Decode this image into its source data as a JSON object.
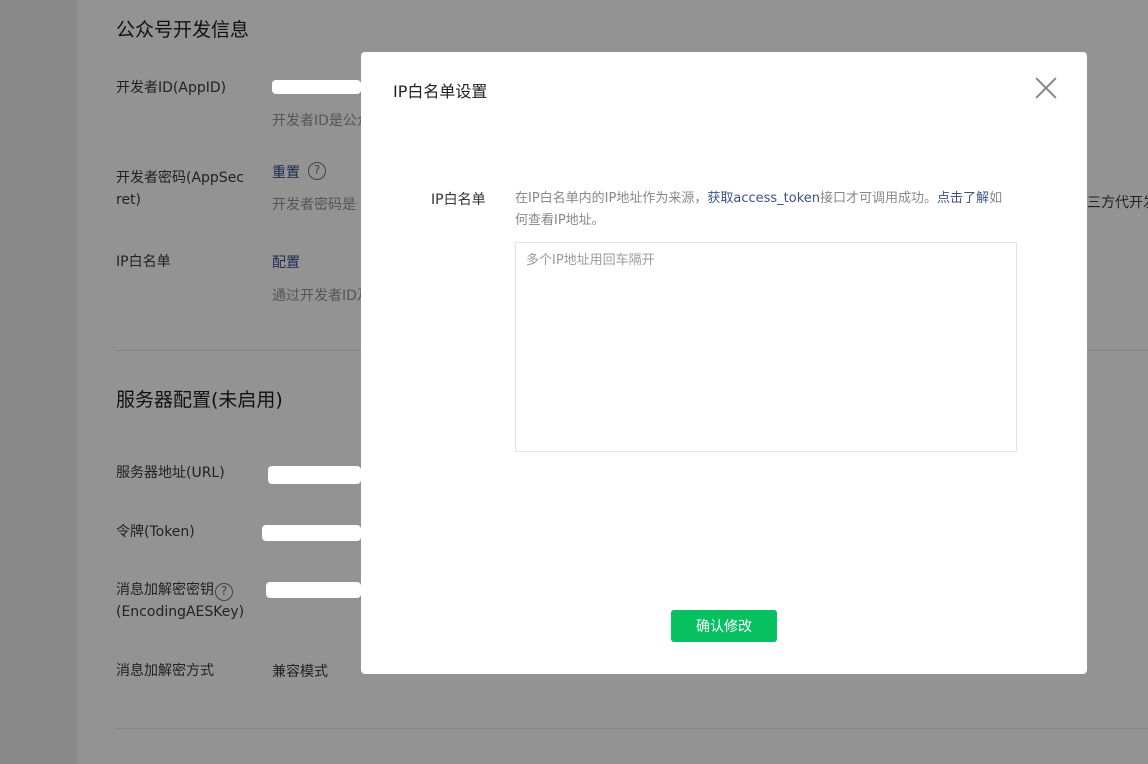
{
  "background": {
    "dev_section": {
      "title": "公众号开发信息",
      "appid_label": "开发者ID(AppID)",
      "appid_desc": "开发者ID是公众",
      "secret_label_1": "开发者密码(AppSec",
      "secret_label_2": "ret)",
      "secret_reset": "重置",
      "secret_desc": "开发者密码是",
      "ip_label": "IP白名单",
      "ip_config": "配置",
      "ip_desc": "通过开发者ID及"
    },
    "server_section": {
      "title": "服务器配置(未启用)",
      "url_label": "服务器地址(URL)",
      "token_label": "令牌(Token)",
      "aes_label_1": "消息加解密密钥",
      "aes_label_2": "(EncodingAESKey)",
      "mode_label": "消息加解密方式",
      "mode_value": "兼容模式"
    },
    "peek_text": "三方代开发"
  },
  "modal": {
    "title": "IP白名单设置",
    "field_label": "IP白名单",
    "hint_prefix": "在IP白名单内的IP地址作为来源，",
    "hint_link_1": "获取access_token",
    "hint_middle": "接口才可调用成功。",
    "hint_link_2": "点击了解",
    "hint_suffix": "如何查看IP地址。",
    "textarea_placeholder": "多个IP地址用回车隔开",
    "textarea_value": "",
    "confirm_label": "确认修改"
  },
  "colors": {
    "accent": "#07c160",
    "link": "#3b5284"
  }
}
